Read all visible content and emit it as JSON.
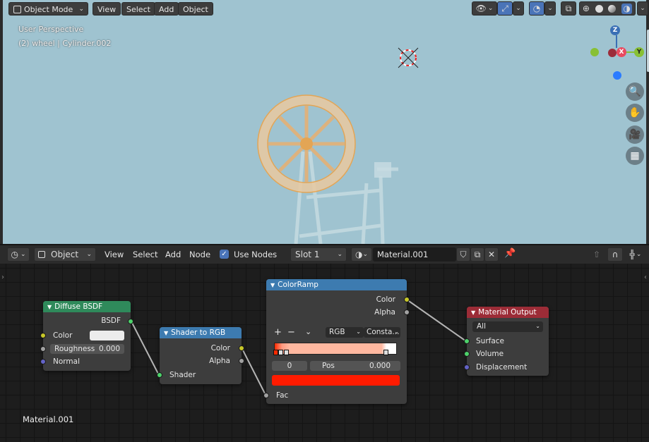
{
  "viewport": {
    "mode_label": "Object Mode",
    "menu": [
      "View",
      "Select",
      "Add",
      "Object"
    ],
    "perspective_text": "User Perspective",
    "object_text": "(2) wheel | Cylinder.002",
    "gizmo": {
      "z": "Z",
      "x": "X",
      "y": "Y"
    }
  },
  "node_header": {
    "editor_type": "Object",
    "menu": [
      "View",
      "Select",
      "Add",
      "Node"
    ],
    "use_nodes_label": "Use Nodes",
    "use_nodes_checked": true,
    "slot_label": "Slot 1",
    "material_name": "Material.001"
  },
  "nodes": {
    "diffuse": {
      "title": "Diffuse BSDF",
      "output": "BSDF",
      "color_label": "Color",
      "roughness_label": "Roughness",
      "roughness_value": "0.000",
      "normal_label": "Normal",
      "header_color": "#2f8a5b"
    },
    "shader_to_rgb": {
      "title": "Shader to RGB",
      "out_color": "Color",
      "out_alpha": "Alpha",
      "in_shader": "Shader",
      "header_color": "#3d7bb0"
    },
    "colorramp": {
      "title": "ColorRamp",
      "out_color": "Color",
      "out_alpha": "Alpha",
      "add_symbol": "+",
      "remove_symbol": "−",
      "mode": "RGB",
      "interpolation": "Consta...",
      "index_value": "0",
      "pos_label": "Pos",
      "pos_value": "0.000",
      "swatch_color": "#ff1b00",
      "in_fac": "Fac",
      "header_color": "#3d7bb0"
    },
    "material_output": {
      "title": "Material Output",
      "target": "All",
      "surface": "Surface",
      "volume": "Volume",
      "displacement": "Displacement",
      "header_color": "#9c2c37"
    }
  },
  "footer_label": "Material.001",
  "colors": {
    "viewport_bg": "#9fc3d0",
    "selection_orange": "#f0a040",
    "socket_shader": "#4dd26b",
    "socket_color": "#c7c729",
    "socket_float": "#a1a1a1",
    "socket_vector": "#6363c7"
  }
}
